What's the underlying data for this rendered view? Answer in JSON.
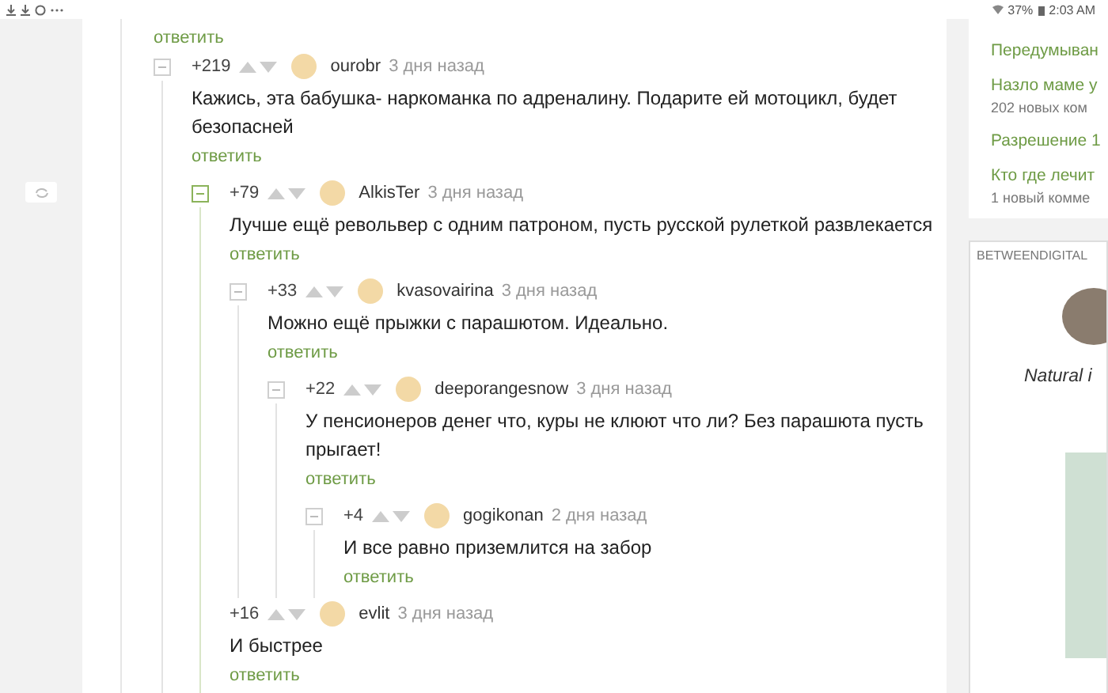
{
  "status_bar": {
    "battery": "37%",
    "time": "2:03 AM"
  },
  "top_reply_link": "ответить",
  "comments": [
    {
      "rating": "+219",
      "user": "ourobr",
      "time": "3 дня назад",
      "text": "Кажись, эта бабушка- наркоманка по адреналину. Подарите ей мотоцикл, будет безопасней",
      "reply": "ответить",
      "collapsible": true,
      "highlighted": false,
      "children": [
        {
          "rating": "+79",
          "user": "AlkisTer",
          "time": "3 дня назад",
          "text": "Лучше ещё револьвер с одним патроном, пусть русской рулеткой развлекается",
          "reply": "ответить",
          "collapsible": true,
          "highlighted": true,
          "children": [
            {
              "rating": "+33",
              "user": "kvasovairina",
              "time": "3 дня назад",
              "text": "Можно ещё прыжки с парашютом. Идеально.",
              "reply": "ответить",
              "collapsible": true,
              "highlighted": false,
              "children": [
                {
                  "rating": "+22",
                  "user": "deeporangesnow",
                  "time": "3 дня назад",
                  "text": "У пенсионеров денег что, куры не клюют что ли? Без парашюта пусть прыгает!",
                  "reply": "ответить",
                  "collapsible": true,
                  "highlighted": false,
                  "children": [
                    {
                      "rating": "+4",
                      "user": "gogikonan",
                      "time": "2 дня назад",
                      "text": "И все равно приземлится на забор",
                      "reply": "ответить",
                      "collapsible": true,
                      "highlighted": false
                    }
                  ]
                }
              ]
            },
            {
              "rating": "+16",
              "user": "evlit",
              "time": "3 дня назад",
              "text": "И быстрее",
              "reply": "ответить",
              "collapsible": false,
              "highlighted": false
            }
          ]
        }
      ]
    }
  ],
  "sidebar": {
    "posts": [
      {
        "title": "Передумыван"
      },
      {
        "title": "Назло маме у",
        "comments": "202 новых ком"
      },
      {
        "title": "Разрешение 1"
      },
      {
        "title": "Кто где лечит",
        "comments": "1 новый комме"
      }
    ]
  },
  "ad": {
    "label": "BETWEENDIGITAL",
    "caption": "Natural i"
  }
}
